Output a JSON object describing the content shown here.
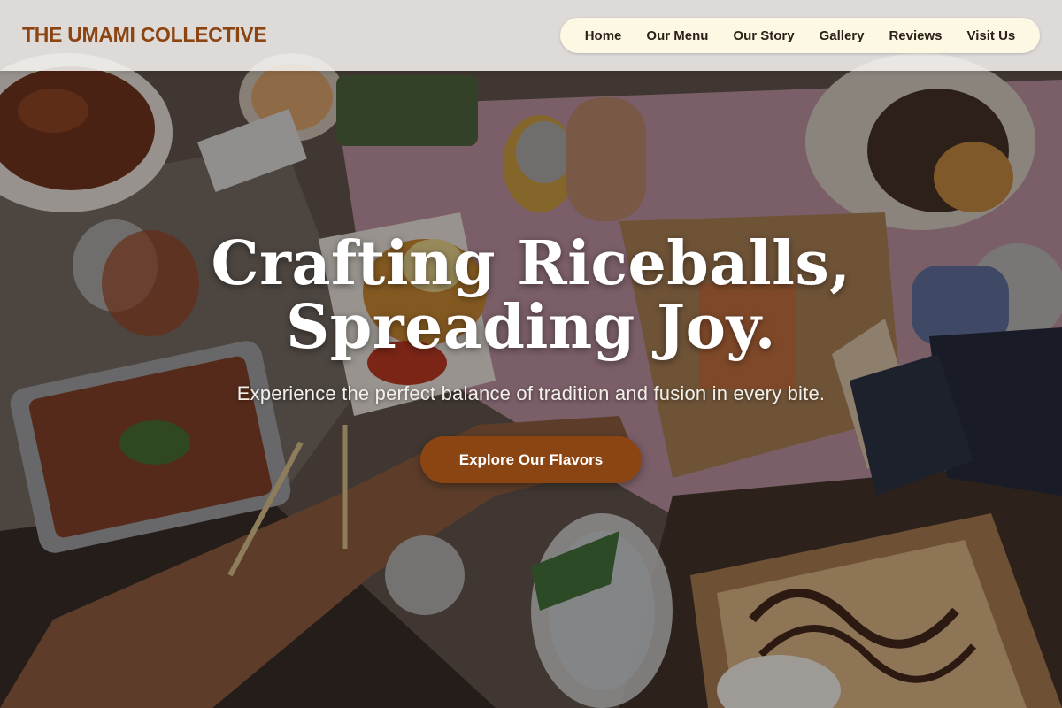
{
  "header": {
    "brand": "THE UMAMI COLLECTIVE",
    "nav": [
      {
        "label": "Home"
      },
      {
        "label": "Our Menu"
      },
      {
        "label": "Our Story"
      },
      {
        "label": "Gallery"
      },
      {
        "label": "Reviews"
      },
      {
        "label": "Visit Us"
      }
    ]
  },
  "hero": {
    "title_line1": "Crafting Riceballs,",
    "title_line2": "Spreading Joy.",
    "subtitle": "Experience the perfect balance of tradition and fusion in every bite.",
    "cta_label": "Explore Our Flavors",
    "background_icon": "food-table-photo"
  },
  "colors": {
    "brand": "#8b4513",
    "nav_pill": "#fdf8e4",
    "nav_text": "#2b2118",
    "hero_text": "#ffffff",
    "cta_background": "#8b4513"
  }
}
